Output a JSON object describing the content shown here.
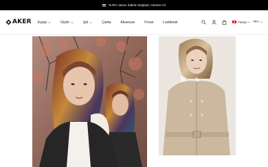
{
  "announcement": {
    "text": "%70'e Varan İndirim Başladı, Hemen Al!",
    "icon": "gift-icon"
  },
  "brand": {
    "name": "AKER"
  },
  "menu": [
    {
      "label": "Eşarp",
      "has_dropdown": true
    },
    {
      "label": "Giyim",
      "has_dropdown": true
    },
    {
      "label": "Şal",
      "has_dropdown": true
    },
    {
      "label": "Çanta",
      "has_dropdown": false
    },
    {
      "label": "Aksesuar",
      "has_dropdown": false
    },
    {
      "label": "Fırsat",
      "has_dropdown": false
    },
    {
      "label": "Lookbook",
      "has_dropdown": false
    }
  ],
  "header_icons": [
    "search-icon",
    "user-icon",
    "bag-icon"
  ],
  "language": {
    "label": "Türkçe",
    "flag": "turkey-flag-icon"
  },
  "currency": {
    "label": "TRY"
  },
  "colors": {
    "announcement_bg": "#000000",
    "flag_red": "#e30a17"
  }
}
